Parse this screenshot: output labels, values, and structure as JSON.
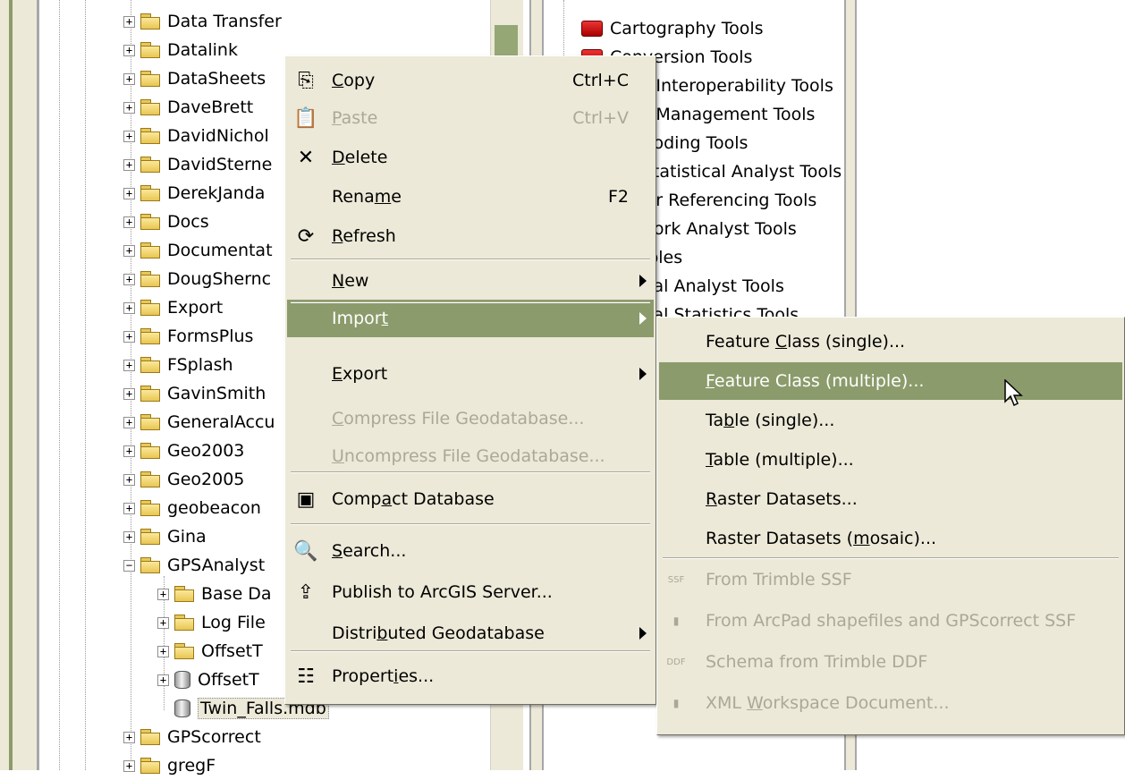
{
  "tree": {
    "items": [
      {
        "label": "Data Transfer",
        "icon": "folder-icon",
        "expander": "+"
      },
      {
        "label": "Datalink",
        "icon": "folder-icon",
        "expander": "+"
      },
      {
        "label": "DataSheets",
        "icon": "folder-icon",
        "expander": "+"
      },
      {
        "label": "DaveBrett",
        "icon": "folder-icon",
        "expander": "+"
      },
      {
        "label": "DavidNichol",
        "icon": "folder-icon",
        "expander": "+"
      },
      {
        "label": "DavidSterne",
        "icon": "folder-icon",
        "expander": "+"
      },
      {
        "label": "DerekJanda",
        "icon": "folder-icon",
        "expander": "+"
      },
      {
        "label": "Docs",
        "icon": "folder-icon",
        "expander": "+"
      },
      {
        "label": "Documentat",
        "icon": "folder-icon",
        "expander": "+"
      },
      {
        "label": "DougShernc",
        "icon": "folder-icon",
        "expander": "+"
      },
      {
        "label": "Export",
        "icon": "folder-icon",
        "expander": "+"
      },
      {
        "label": "FormsPlus",
        "icon": "folder-icon",
        "expander": "+"
      },
      {
        "label": "FSplash",
        "icon": "folder-icon",
        "expander": "+"
      },
      {
        "label": "GavinSmith",
        "icon": "folder-icon",
        "expander": "+"
      },
      {
        "label": "GeneralAccu",
        "icon": "folder-icon",
        "expander": "+"
      },
      {
        "label": "Geo2003",
        "icon": "folder-icon",
        "expander": "+"
      },
      {
        "label": "Geo2005",
        "icon": "folder-icon",
        "expander": "+"
      },
      {
        "label": "geobeacon",
        "icon": "folder-icon",
        "expander": "+"
      },
      {
        "label": "Gina",
        "icon": "folder-icon",
        "expander": "+"
      },
      {
        "label": "GPSAnalyst",
        "icon": "folder-icon",
        "expander": "−"
      }
    ],
    "children": [
      {
        "label": "Base Da",
        "icon": "folder-icon",
        "expander": "+"
      },
      {
        "label": "Log File",
        "icon": "folder-icon",
        "expander": "+"
      },
      {
        "label": "OffsetT",
        "icon": "folder-icon",
        "expander": "+"
      },
      {
        "label": "OffsetT",
        "icon": "database-icon",
        "expander": "+"
      },
      {
        "label": "Twin_Falls.mdb",
        "icon": "database-icon",
        "expander": ""
      }
    ],
    "after": [
      {
        "label": "GPScorrect",
        "icon": "folder-icon",
        "expander": "+"
      },
      {
        "label": "gregF",
        "icon": "folder-icon",
        "expander": "+"
      }
    ]
  },
  "toolbox": {
    "items": [
      "Cartography Tools",
      "Conversion Tools",
      "Data Interoperability Tools",
      "Data Management Tools",
      "Geocoding Tools",
      "Geostatistical Analyst Tools",
      "Linear Referencing Tools",
      "Network Analyst Tools",
      "Samples",
      "Spatial Analyst Tools",
      "Spatial Statistics Tools"
    ]
  },
  "context_menu": {
    "items": [
      {
        "pre": "",
        "key": "C",
        "post": "opy",
        "shortcut": "Ctrl+C",
        "icon": "copy-icon",
        "state": "normal"
      },
      {
        "pre": "",
        "key": "P",
        "post": "aste",
        "shortcut": "Ctrl+V",
        "icon": "paste-icon",
        "state": "disabled"
      },
      {
        "pre": "",
        "key": "D",
        "post": "elete",
        "shortcut": "",
        "icon": "delete-icon",
        "state": "normal"
      },
      {
        "pre": "Rena",
        "key": "m",
        "post": "e",
        "shortcut": "F2",
        "icon": "",
        "state": "normal"
      },
      {
        "pre": "",
        "key": "R",
        "post": "efresh",
        "shortcut": "",
        "icon": "refresh-icon",
        "state": "normal"
      },
      {
        "pre": "",
        "key": "N",
        "post": "ew",
        "shortcut": "",
        "icon": "",
        "state": "normal"
      },
      {
        "pre": "Impor",
        "key": "t",
        "post": "",
        "shortcut": "",
        "icon": "",
        "state": "highlighted"
      },
      {
        "pre": "",
        "key": "E",
        "post": "xport",
        "shortcut": "",
        "icon": "",
        "state": "normal"
      },
      {
        "pre": "",
        "key": "C",
        "post": "ompress File Geodatabase...",
        "shortcut": "",
        "icon": "",
        "state": "disabled"
      },
      {
        "pre": "",
        "key": "U",
        "post": "ncompress File Geodatabase...",
        "shortcut": "",
        "icon": "",
        "state": "disabled"
      },
      {
        "pre": "Comp",
        "key": "a",
        "post": "ct Database",
        "shortcut": "",
        "icon": "compact-database-icon",
        "state": "normal"
      },
      {
        "pre": "",
        "key": "S",
        "post": "earch...",
        "shortcut": "",
        "icon": "search-icon",
        "state": "normal"
      },
      {
        "pre": "Publish to ArcGIS Server...",
        "key": "",
        "post": "",
        "shortcut": "",
        "icon": "publish-icon",
        "state": "normal"
      },
      {
        "pre": "Distri",
        "key": "b",
        "post": "uted Geodatabase",
        "shortcut": "",
        "icon": "",
        "state": "normal"
      },
      {
        "pre": "Propert",
        "key": "i",
        "post": "es...",
        "shortcut": "",
        "icon": "properties-icon",
        "state": "normal"
      }
    ]
  },
  "import_submenu": {
    "items": [
      {
        "pre": "Feature ",
        "key": "C",
        "post": "lass (single)...",
        "icon": "",
        "state": "normal"
      },
      {
        "pre": "",
        "key": "F",
        "post": "eature Class (multiple)...",
        "icon": "",
        "state": "highlighted"
      },
      {
        "pre": "Ta",
        "key": "b",
        "post": "le (single)...",
        "icon": "",
        "state": "normal"
      },
      {
        "pre": "",
        "key": "T",
        "post": "able (multiple)...",
        "icon": "",
        "state": "normal"
      },
      {
        "pre": "",
        "key": "R",
        "post": "aster Datasets...",
        "icon": "",
        "state": "normal"
      },
      {
        "pre": "Raster Datasets (",
        "key": "m",
        "post": "osaic)...",
        "icon": "",
        "state": "normal"
      },
      {
        "pre": "From Trimble SSF",
        "key": "",
        "post": "",
        "icon": "ssf-icon",
        "icon_text": "SSF",
        "state": "disabled"
      },
      {
        "pre": "From ArcPad shapefiles and GPScorrect SSF",
        "key": "",
        "post": "",
        "icon": "arcpad-icon",
        "icon_text": "",
        "state": "disabled"
      },
      {
        "pre": "Schema from Trimble DDF",
        "key": "",
        "post": "",
        "icon": "ddf-icon",
        "icon_text": "DDF",
        "state": "disabled"
      },
      {
        "pre": "XML ",
        "key": "W",
        "post": "orkspace Document...",
        "icon": "xml-icon",
        "icon_text": "",
        "state": "disabled"
      }
    ]
  },
  "colors": {
    "menu_bg": "#ece9d8",
    "highlight": "#8b9b6b",
    "disabled_text": "#aca899"
  }
}
